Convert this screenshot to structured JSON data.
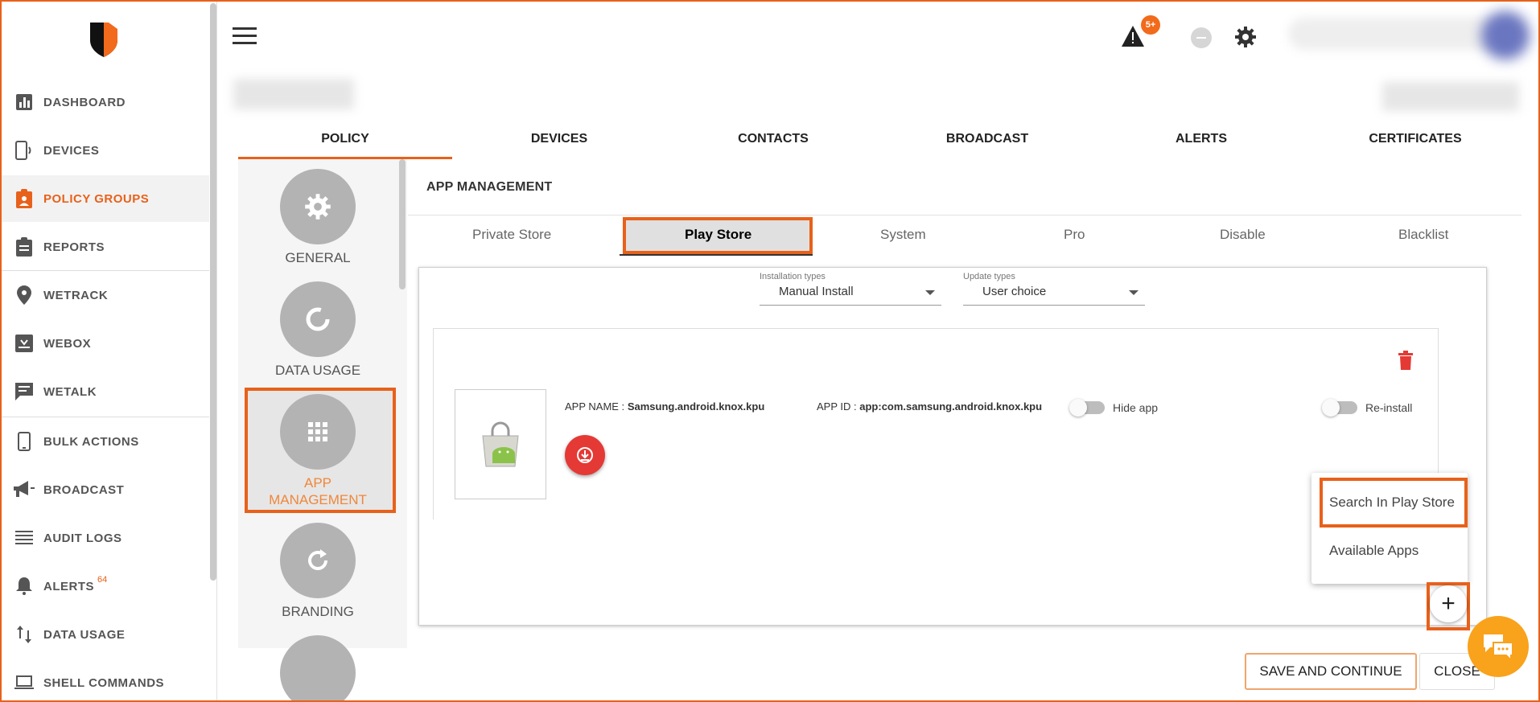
{
  "sidebar": {
    "items": [
      {
        "label": "DASHBOARD",
        "icon": "bar-chart-icon"
      },
      {
        "label": "DEVICES",
        "icon": "device-icon"
      },
      {
        "label": "POLICY GROUPS",
        "icon": "clipboard-icon"
      },
      {
        "label": "REPORTS",
        "icon": "report-icon"
      },
      {
        "label": "WETRACK",
        "icon": "location-pin-icon"
      },
      {
        "label": "WEBOX",
        "icon": "inbox-icon"
      },
      {
        "label": "WETALK",
        "icon": "chat-icon"
      },
      {
        "label": "BULK ACTIONS",
        "icon": "phone-icon"
      },
      {
        "label": "BROADCAST",
        "icon": "megaphone-icon"
      },
      {
        "label": "AUDIT LOGS",
        "icon": "list-icon"
      },
      {
        "label": "ALERTS",
        "icon": "bell-icon",
        "badge": "64"
      },
      {
        "label": "DATA USAGE",
        "icon": "arrows-updown-icon"
      },
      {
        "label": "SHELL COMMANDS",
        "icon": "laptop-icon"
      }
    ]
  },
  "topbar": {
    "alert_badge": "5+"
  },
  "main_tabs": [
    "POLICY",
    "DEVICES",
    "CONTACTS",
    "BROADCAST",
    "ALERTS",
    "CERTIFICATES"
  ],
  "policy_panel": {
    "items": [
      {
        "label": "GENERAL",
        "icon": "gear-icon"
      },
      {
        "label": "DATA USAGE",
        "icon": "loading-circle-icon"
      },
      {
        "label": "APP MANAGEMENT",
        "icon": "grid-icon"
      },
      {
        "label": "BRANDING",
        "icon": "refresh-icon"
      }
    ]
  },
  "app_management": {
    "title": "APP MANAGEMENT",
    "sub_tabs": [
      "Private Store",
      "Play Store",
      "System",
      "Pro",
      "Disable",
      "Blacklist"
    ],
    "installation_types": {
      "label": "Installation types",
      "value": "Manual Install"
    },
    "update_types": {
      "label": "Update types",
      "value": "User choice"
    },
    "app": {
      "name_label": "APP NAME :",
      "name_value": "Samsung.android.knox.kpu",
      "id_label": "APP ID :",
      "id_value": "app:com.samsung.android.knox.kpu",
      "hide_app": "Hide app",
      "reinstall": "Re-install"
    },
    "menu": [
      "Search In Play Store",
      "Available Apps"
    ],
    "fab_label": "+"
  },
  "footer": {
    "save": "SAVE AND CONTINUE",
    "close": "CLOSE"
  },
  "colors": {
    "accent": "#e8611a",
    "danger": "#e53935",
    "chat": "#f9a21b"
  }
}
